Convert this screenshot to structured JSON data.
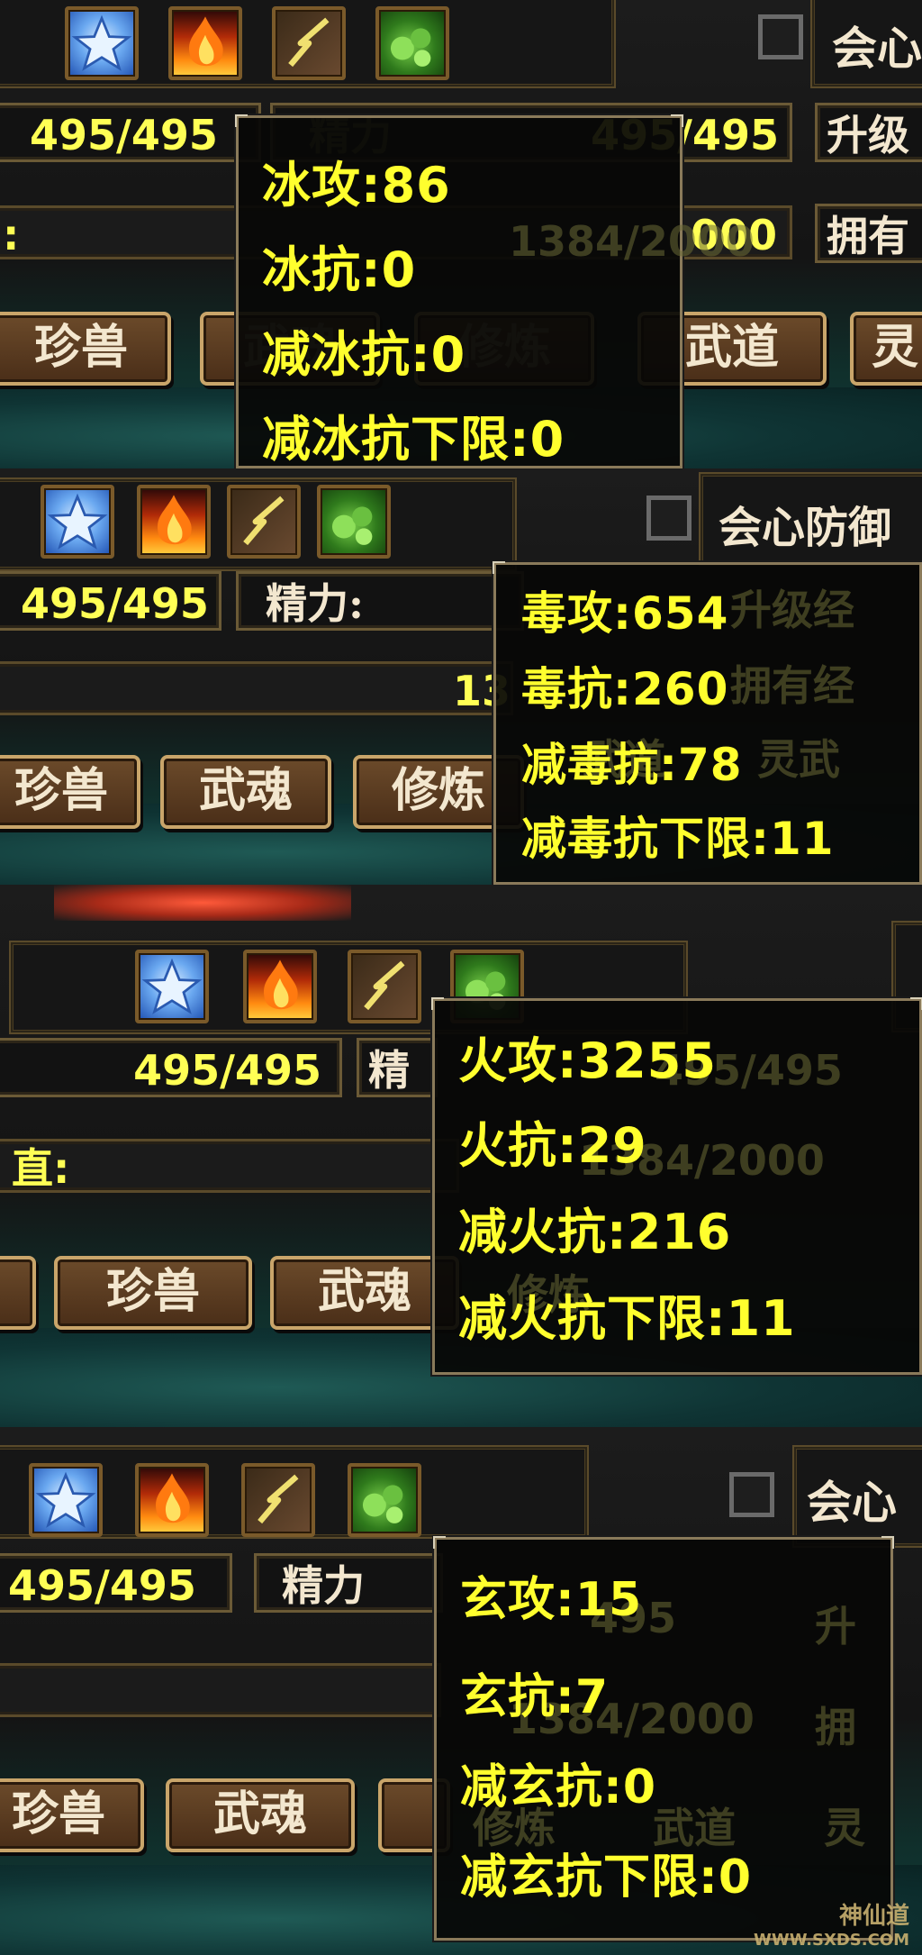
{
  "panels": [
    {
      "element": "ice",
      "stat_left": "495/495",
      "stat_mid_label": "精力",
      "stat_mid_value": "495/495",
      "stat_right_value": "495",
      "bar_value": "1384/2000",
      "bar_value_tail": "000",
      "right_labels": [
        "会心",
        "升级",
        "拥有"
      ],
      "buttons": [
        "珍兽",
        "武魂",
        "修炼",
        "武道",
        "灵"
      ],
      "tooltip": {
        "lines": [
          {
            "label": "冰攻",
            "value": "86"
          },
          {
            "label": "冰抗",
            "value": "0"
          },
          {
            "label": "减冰抗",
            "value": "0"
          },
          {
            "label": "减冰抗下限",
            "value": "0"
          }
        ]
      }
    },
    {
      "element": "poison",
      "stat_left": "495/495",
      "stat_mid_label": "精力:",
      "bar_value": "13",
      "right_labels": [
        "会心防御",
        "升级经",
        "拥有经"
      ],
      "buttons": [
        "珍兽",
        "武魂",
        "修炼",
        "武道",
        "灵武"
      ],
      "tooltip": {
        "lines": [
          {
            "label": "毒攻",
            "value": "654"
          },
          {
            "label": "毒抗",
            "value": "260"
          },
          {
            "label": "减毒抗",
            "value": "78"
          },
          {
            "label": "减毒抗下限",
            "value": "11"
          }
        ]
      }
    },
    {
      "element": "fire",
      "stat_left": "495/495",
      "stat_mid_label": "精",
      "stat_mid_value": "495/495",
      "bar_label": "直:",
      "bar_value": "1384/2000",
      "buttons": [
        "珍兽",
        "武魂",
        "修炼"
      ],
      "tooltip": {
        "lines": [
          {
            "label": "火攻",
            "value": "3255"
          },
          {
            "label": "火抗",
            "value": "29"
          },
          {
            "label": "减火抗",
            "value": "216"
          },
          {
            "label": "减火抗下限",
            "value": "11"
          }
        ]
      }
    },
    {
      "element": "mystic",
      "stat_left": "495/495",
      "stat_mid_label": "精力",
      "stat_mid_value": "495",
      "bar_value": "1384/2000",
      "right_labels": [
        "会心",
        "升",
        "拥"
      ],
      "buttons": [
        "珍兽",
        "武魂",
        "修炼",
        "武道",
        "灵"
      ],
      "tooltip": {
        "lines": [
          {
            "label": "玄攻",
            "value": "15"
          },
          {
            "label": "玄抗",
            "value": "7"
          },
          {
            "label": "减玄抗",
            "value": "0"
          },
          {
            "label": "减玄抗下限",
            "value": "0"
          }
        ]
      }
    }
  ],
  "icons": [
    "ice-star-icon",
    "fire-icon",
    "lightning-icon",
    "poison-icon"
  ],
  "watermark": {
    "text": "神仙道",
    "url": "WWW.SXDS.COM"
  },
  "colors": {
    "tooltip_text": "#ffff2e",
    "stat_text": "#ffff55",
    "button_frame": "#c9a56a"
  }
}
